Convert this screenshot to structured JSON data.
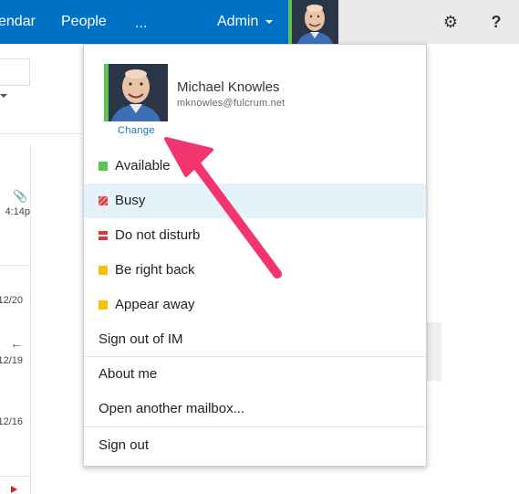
{
  "topbar": {
    "items": [
      {
        "label": "endar"
      },
      {
        "label": "People"
      },
      {
        "label": "..."
      },
      {
        "label": "Admin"
      }
    ],
    "settings_icon": "gear-icon",
    "help_label": "?"
  },
  "left_list": {
    "times": [
      "4:14p",
      "12/20",
      "12/19",
      "12/16"
    ]
  },
  "profile": {
    "name": "Michael Knowles",
    "email": "mknowles@fulcrum.net",
    "change_label": "Change"
  },
  "status_items": [
    {
      "label": "Available",
      "color": "#5ec252"
    },
    {
      "label": "Busy",
      "color": "#d9363e"
    },
    {
      "label": "Do not disturb",
      "color": "#d9363e"
    },
    {
      "label": "Be right back",
      "color": "#f5c400"
    },
    {
      "label": "Appear away",
      "color": "#f5c400"
    }
  ],
  "menu": {
    "sign_out_im": "Sign out of IM",
    "about_me": "About me",
    "open_mailbox": "Open another mailbox...",
    "sign_out": "Sign out"
  },
  "colors": {
    "accent": "#0072c6",
    "presence": "#5ec252",
    "annotation_arrow": "#f2346f"
  }
}
